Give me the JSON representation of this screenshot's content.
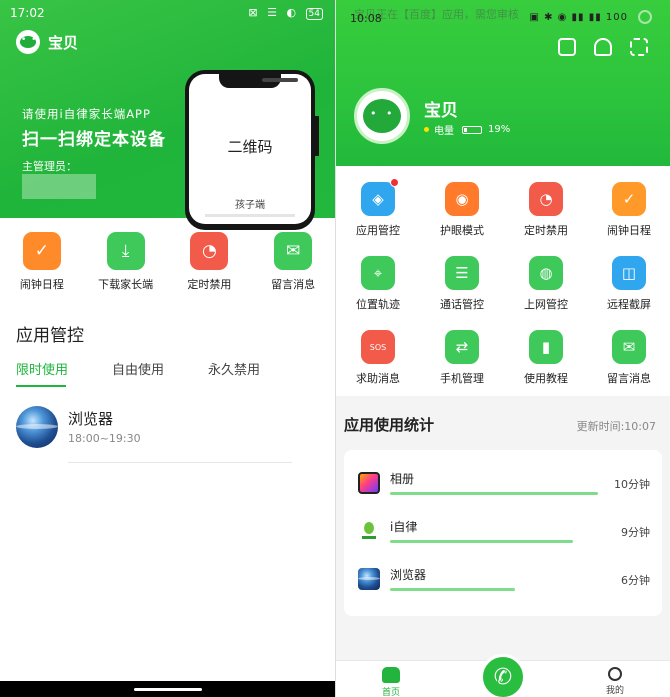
{
  "left": {
    "statusbar": {
      "time": "17:02",
      "icons": "⊠ ☰ ◐",
      "battery": "54"
    },
    "hero": {
      "brand_name": "宝贝",
      "subtitle": "请使用i自律家长端APP",
      "title": "扫一扫绑定本设备",
      "admin_label": "主管理员：",
      "phone_qr_text": "二维码",
      "phone_label": "孩子端"
    },
    "quick_actions": [
      {
        "label": "闹钟日程",
        "icon": "alarm-check-icon",
        "color": "#ff8a2a",
        "glyph": "✓"
      },
      {
        "label": "下载家长端",
        "icon": "download-icon",
        "color": "#3ec95a",
        "glyph": "⤓"
      },
      {
        "label": "定时禁用",
        "icon": "clock-icon",
        "color": "#f25a4a",
        "glyph": "◔"
      },
      {
        "label": "留言消息",
        "icon": "mail-icon",
        "color": "#3ec95a",
        "glyph": "✉"
      }
    ],
    "section_title": "应用管控",
    "tabs": [
      {
        "label": "限时使用",
        "active": true
      },
      {
        "label": "自由使用",
        "active": false
      },
      {
        "label": "永久禁用",
        "active": false
      }
    ],
    "items": [
      {
        "name": "浏览器",
        "time": "18:00~19:30",
        "icon": "browser-globe-icon"
      }
    ]
  },
  "right": {
    "statusbar": {
      "time": "10:08",
      "notice": "宝贝正在【百度】应用，需您审核",
      "icons": "▣ ✱ ◉ ▮▮ ▮▮ 100"
    },
    "top_icons": [
      "calendar-icon",
      "bell-icon",
      "scan-icon"
    ],
    "profile": {
      "name": "宝贝",
      "battery_label": "电量",
      "battery_value": "19%"
    },
    "grid": [
      {
        "label": "应用管控",
        "icon": "app-control-icon",
        "color": "#2fa6ee",
        "glyph": "◈",
        "badge": true
      },
      {
        "label": "护眼模式",
        "icon": "eye-icon",
        "color": "#ff7a2a",
        "glyph": "◉",
        "badge": false
      },
      {
        "label": "定时禁用",
        "icon": "clock-icon",
        "color": "#f25a4a",
        "glyph": "◔",
        "badge": false
      },
      {
        "label": "闹钟日程",
        "icon": "alarm-calendar-icon",
        "color": "#ff9a2a",
        "glyph": "✓",
        "badge": false
      },
      {
        "label": "位置轨迹",
        "icon": "location-icon",
        "color": "#3ec95a",
        "glyph": "⌖",
        "badge": false
      },
      {
        "label": "通话管控",
        "icon": "call-record-icon",
        "color": "#3ec95a",
        "glyph": "☰",
        "badge": false
      },
      {
        "label": "上网管控",
        "icon": "planet-icon",
        "color": "#3ec95a",
        "glyph": "◍",
        "badge": false
      },
      {
        "label": "远程截屏",
        "icon": "screenshot-icon",
        "color": "#2fa6ee",
        "glyph": "◫",
        "badge": false
      },
      {
        "label": "求助消息",
        "icon": "sos-icon",
        "color": "#f25a4a",
        "glyph": "SOS",
        "badge": false
      },
      {
        "label": "手机管理",
        "icon": "phone-settings-icon",
        "color": "#3ec95a",
        "glyph": "⇄",
        "badge": false
      },
      {
        "label": "使用教程",
        "icon": "tutorial-book-icon",
        "color": "#3ec95a",
        "glyph": "▮",
        "badge": false
      },
      {
        "label": "留言消息",
        "icon": "mail-icon",
        "color": "#3ec95a",
        "glyph": "✉",
        "badge": false
      }
    ],
    "stats": {
      "title": "应用使用统计",
      "updated": "更新时间:10:07",
      "rows": [
        {
          "name": "相册",
          "duration": "10分钟",
          "icon": "album-icon",
          "cls": "album",
          "fraction": 0.83
        },
        {
          "name": "i自律",
          "duration": "9分钟",
          "icon": "ilv-app-icon",
          "cls": "ilv",
          "fraction": 0.73
        },
        {
          "name": "浏览器",
          "duration": "6分钟",
          "icon": "browser-globe-icon",
          "cls": "globe",
          "fraction": 0.5
        }
      ]
    },
    "bottom_nav": {
      "home_label": "首页",
      "mine_label": "我的"
    }
  }
}
